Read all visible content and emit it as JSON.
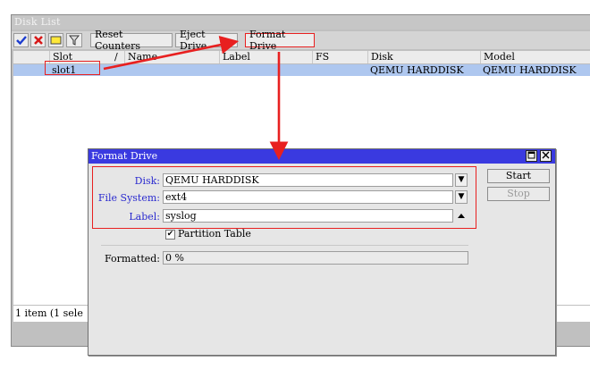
{
  "disk_list": {
    "title": "Disk List",
    "toolbar": {
      "reset_counters": "Reset Counters",
      "eject_drive": "Eject Drive",
      "format_drive": "Format Drive"
    },
    "columns": [
      "Slot",
      "/",
      "Name",
      "Label",
      "FS",
      "Disk",
      "Model"
    ],
    "row": {
      "slot": "slot1",
      "disk": "QEMU HARDDISK",
      "model": "QEMU HARDDISK"
    },
    "status": "1 item (1 sele"
  },
  "format_drive": {
    "title": "Format Drive",
    "disk_label": "Disk:",
    "disk_value": "QEMU HARDDISK",
    "fs_label": "File System:",
    "fs_value": "ext4",
    "label_label": "Label:",
    "label_value": "syslog",
    "partition_table": "Partition Table",
    "formatted_label": "Formatted:",
    "formatted_value": "0 %",
    "start": "Start",
    "stop": "Stop"
  },
  "colors": {
    "highlight": "#e82020",
    "selection": "#aec7ef",
    "dialog_title": "#3a3ae0"
  }
}
